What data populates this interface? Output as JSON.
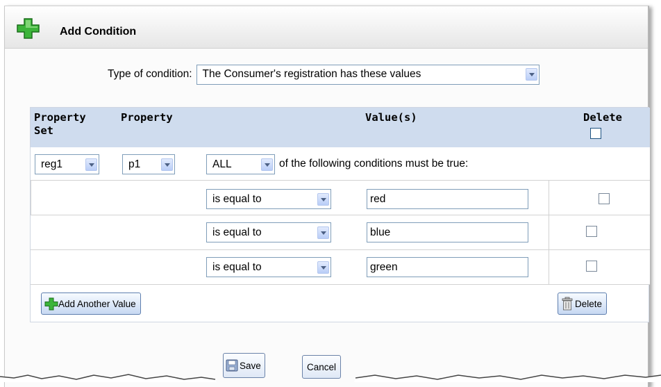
{
  "dialog": {
    "title": "Add Condition"
  },
  "condition_type": {
    "label": "Type of condition:",
    "selected": "The Consumer's registration has these values"
  },
  "table": {
    "headers": {
      "property_set": "Property Set",
      "property": "Property",
      "values": "Value(s)",
      "delete": "Delete"
    },
    "selection_row": {
      "property_set": "reg1",
      "property": "p1",
      "match_mode": "ALL",
      "match_text": "of the following conditions must be true:"
    },
    "value_rows": [
      {
        "operator": "is equal to",
        "value": "red"
      },
      {
        "operator": "is equal to",
        "value": "blue"
      },
      {
        "operator": "is equal to",
        "value": "green"
      }
    ],
    "add_value_label": "Add Another Value",
    "delete_label": "Delete"
  },
  "footer": {
    "save_label": "Save",
    "cancel_label": "Cancel"
  },
  "colors": {
    "header_bg": "#cfdcee",
    "plus_green": "#22a020",
    "border_blue": "#7f9db9"
  },
  "icons": [
    "add-plus-icon",
    "dropdown-arrow-icon",
    "trash-icon",
    "save-disk-icon"
  ]
}
